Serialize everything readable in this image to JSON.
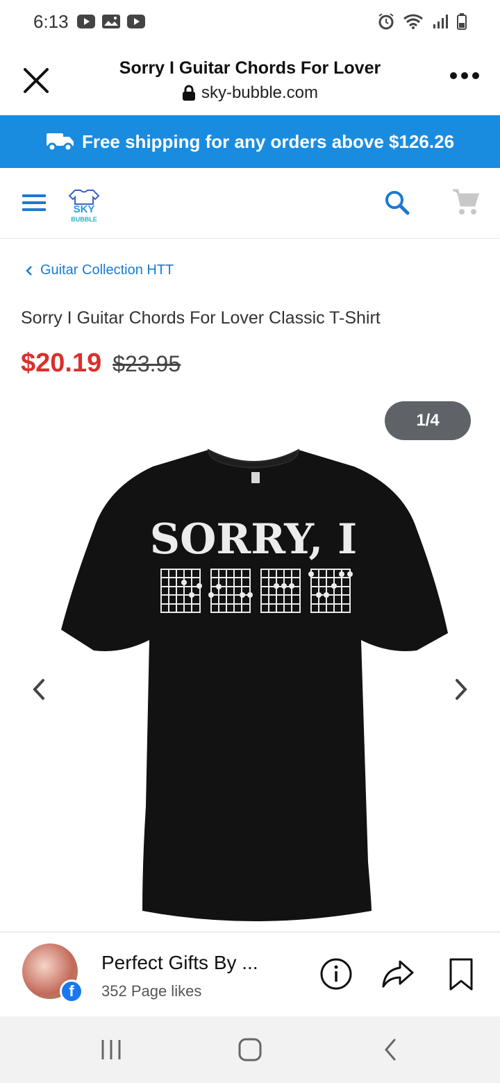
{
  "status_bar": {
    "time": "6:13"
  },
  "browser": {
    "title": "Sorry I Guitar Chords For Lover",
    "url": "sky-bubble.com"
  },
  "banner": {
    "text": "Free shipping for any orders above $126.26"
  },
  "site": {
    "logo_top": "SKY",
    "logo_bottom": "BUBBLE"
  },
  "breadcrumb": {
    "label": "Guitar Collection HTT"
  },
  "product": {
    "title": "Sorry I Guitar Chords For Lover Classic T-Shirt",
    "price_sale": "$20.19",
    "price_original": "$23.95",
    "image_counter": "1/4",
    "shirt_print_text": "SORRY, I"
  },
  "facebook": {
    "page_name": "Perfect Gifts By ...",
    "likes": "352 Page likes"
  },
  "colors": {
    "banner_bg": "#1a8ce0",
    "link": "#1a7ad4",
    "price_sale": "#d9302c",
    "counter_bg": "#5f6368"
  }
}
